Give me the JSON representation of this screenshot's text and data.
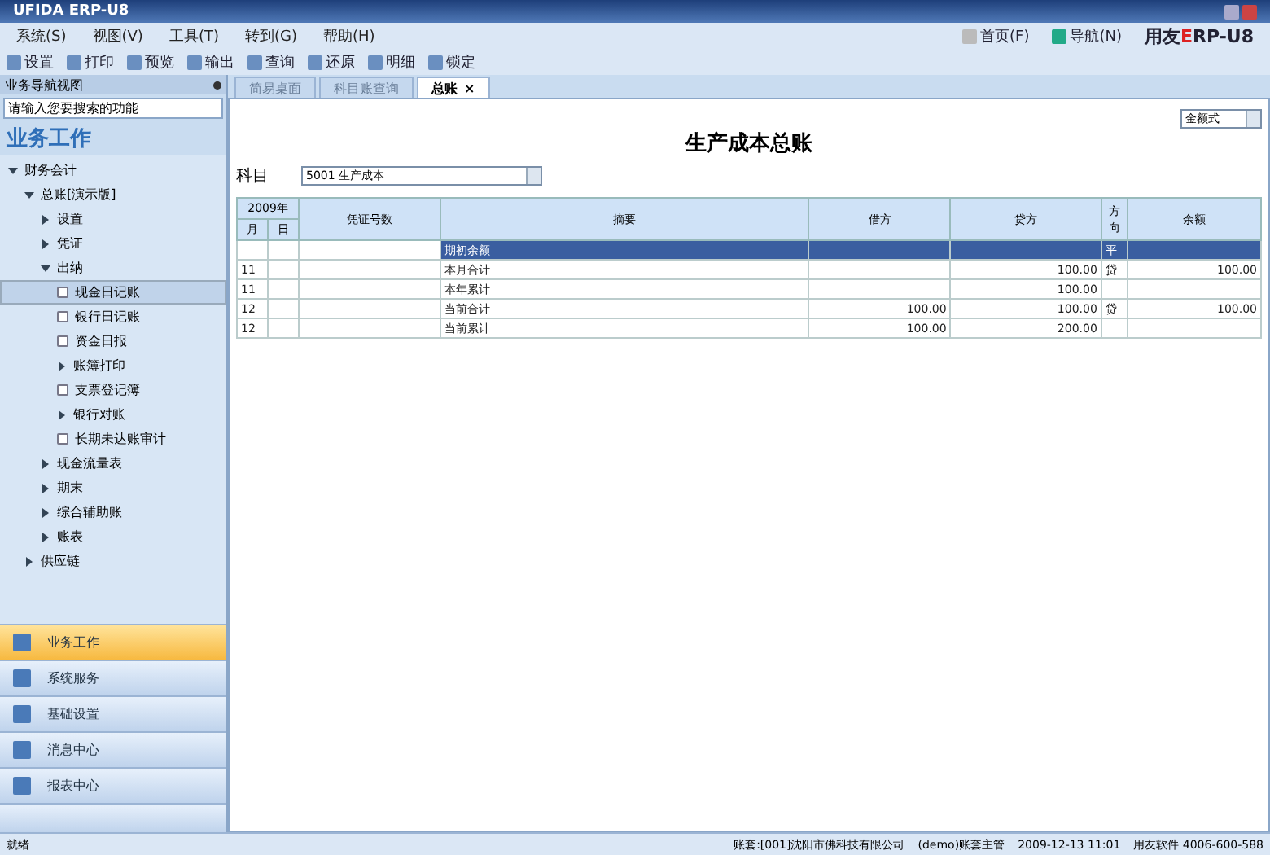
{
  "window": {
    "title": "UFIDA ERP-U8"
  },
  "menu": [
    "系统(S)",
    "视图(V)",
    "工具(T)",
    "转到(G)",
    "帮助(H)"
  ],
  "toolbar": [
    "设置",
    "打印",
    "预览",
    "输出",
    "查询",
    "还原",
    "明细",
    "锁定"
  ],
  "top_links": [
    {
      "label": "首页(F)"
    },
    {
      "label": "导航(N)"
    }
  ],
  "brand": {
    "prefix": "用友",
    "accent": "E",
    "rest": "RP-U8"
  },
  "nav_panel": {
    "title": "业务导航视图",
    "search": {
      "value": "请输入您要搜索的功能"
    },
    "heading": "业务工作",
    "tree": [
      {
        "label": "财务会计",
        "expanded": true,
        "children": [
          {
            "label": "总账[演示版]",
            "expanded": true,
            "children": [
              {
                "label": "设置",
                "expanded": false
              },
              {
                "label": "凭证",
                "expanded": false
              },
              {
                "label": "出纳",
                "expanded": true,
                "children": [
                  {
                    "label": "现金日记账",
                    "selected": true,
                    "kind": "doc"
                  },
                  {
                    "label": "银行日记账",
                    "selected": false,
                    "kind": "doc"
                  },
                  {
                    "label": "资金日报",
                    "selected": false,
                    "kind": "doc"
                  },
                  {
                    "label": "账簿打印",
                    "selected": false,
                    "kind": "folder"
                  },
                  {
                    "label": "支票登记簿",
                    "selected": false,
                    "kind": "doc"
                  },
                  {
                    "label": "银行对账",
                    "selected": false,
                    "kind": "folder"
                  },
                  {
                    "label": "长期未达账审计",
                    "selected": false,
                    "kind": "doc"
                  }
                ]
              },
              {
                "label": "现金流量表",
                "expanded": false
              },
              {
                "label": "期末",
                "expanded": false
              },
              {
                "label": "综合辅助账",
                "expanded": false
              },
              {
                "label": "账表",
                "expanded": false
              }
            ]
          },
          {
            "label": "供应链",
            "expanded": false
          }
        ]
      }
    ],
    "sections": [
      {
        "label": "业务工作",
        "selected": true
      },
      {
        "label": "系统服务",
        "selected": false
      },
      {
        "label": "基础设置",
        "selected": false
      },
      {
        "label": "消息中心",
        "selected": false
      },
      {
        "label": "报表中心",
        "selected": false
      }
    ]
  },
  "tabs": [
    {
      "label": "简易桌面",
      "selected": false
    },
    {
      "label": "科目账查询",
      "selected": false
    },
    {
      "label": "总账",
      "selected": true,
      "close": "×"
    }
  ],
  "report": {
    "title": "生产成本总账",
    "subject_label": "科目",
    "subject": "5001 生产成本",
    "format": "金额式",
    "year": "2009年",
    "columns": [
      "月",
      "日",
      "凭证号数",
      "摘要",
      "借方",
      "贷方",
      "方向",
      "余额"
    ],
    "rows": [
      {
        "month": "",
        "summary": "期初余额",
        "debit": "",
        "credit": "",
        "direction": "平",
        "balance": "",
        "selected": true
      },
      {
        "month": "11",
        "summary": "本月合计",
        "debit": "",
        "credit": "100.00",
        "direction": "贷",
        "balance": "100.00",
        "selected": false
      },
      {
        "month": "11",
        "summary": "本年累计",
        "debit": "",
        "credit": "100.00",
        "direction": "",
        "balance": "",
        "selected": false
      },
      {
        "month": "12",
        "summary": "当前合计",
        "debit": "100.00",
        "credit": "100.00",
        "direction": "贷",
        "balance": "100.00",
        "selected": false
      },
      {
        "month": "12",
        "summary": "当前累计",
        "debit": "100.00",
        "credit": "200.00",
        "direction": "",
        "balance": "",
        "selected": false
      }
    ]
  },
  "status_bar": {
    "state": "就绪",
    "items": [
      "账套:[001]沈阳市佛科技有限公司",
      "(demo)账套主管",
      "2009-12-13 11:01",
      "用友软件 4006-600-588"
    ]
  }
}
